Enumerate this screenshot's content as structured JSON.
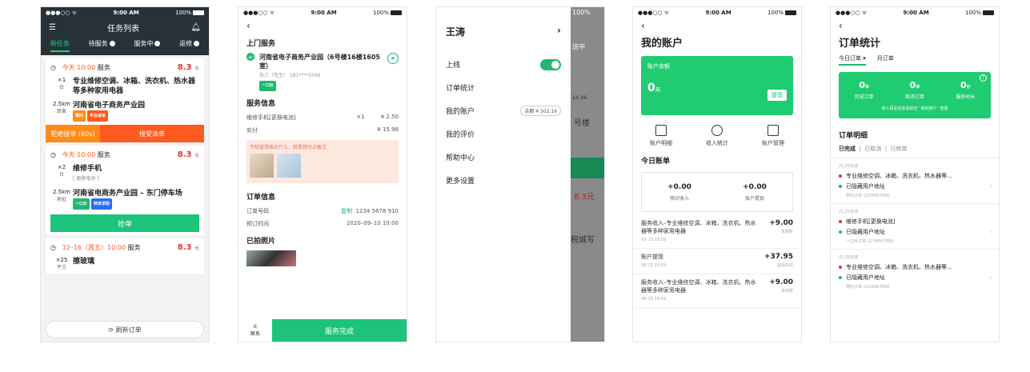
{
  "status": {
    "time": "9:00 AM",
    "battery": "100%"
  },
  "p1": {
    "title": "任务列表",
    "tabs": [
      "新任务",
      "待服务",
      "服务中",
      "返修"
    ],
    "cards": [
      {
        "time": "今天 10:00",
        "type": "服务",
        "price": "8.3",
        "unit": "元",
        "qty": "×1",
        "qtyu": "台",
        "title": "专业维修空调、冰箱、洗衣机、热水器等多种家用电器",
        "dist": "2.5km",
        "distu": "距离",
        "addr": "河南省电子商务产业园",
        "tags": [
          "预约",
          "平台派单"
        ]
      },
      {
        "time": "今天 10:00",
        "type": "服务",
        "price": "8.3",
        "unit": "元",
        "qty": "×2",
        "qtyu": "台",
        "title": "维修手机",
        "sub": "[ 更换电池 ]",
        "dist": "2.5km",
        "distu": "地址",
        "addr": "河南省电商务产业园 – 东门停车场",
        "tags": [
          "一口价",
          "转单求助"
        ]
      },
      {
        "time": "12–16（周五）10:00",
        "type": "服务",
        "price": "8.3",
        "unit": "元",
        "qty": "×25",
        "qtyu": "平方",
        "title": "擦玻璃"
      }
    ],
    "reject": "拒绝接单 (60s)",
    "accept": "接受派单",
    "grab": "抢单",
    "refresh": "刷新订单"
  },
  "p2": {
    "sec1": "上门服务",
    "addr": "河南省电子商务产业园（6号楼16楼1605室）",
    "person": "张三（先生）  181****5566",
    "tag": "一口价",
    "sec2": "服务信息",
    "item": "维修手机[更换电池]",
    "item_qty": "×1",
    "item_price": "¥ 2.50",
    "paid": "实付",
    "paid_val": "¥ 15.98",
    "note": "不知道想表达什么，就是想写点备注",
    "sec3": "订单信息",
    "ono": "订单号码",
    "copy": "复制",
    "ono_val": "1234 5678 910",
    "otime": "预订时间",
    "otime_val": "2020–09–10 10:00",
    "sec4": "已拍照片",
    "contact": "联系",
    "done": "服务完成"
  },
  "p3": {
    "name": "王涛",
    "online": "上线",
    "items": [
      "订单统计",
      "我的账户",
      "我的评价",
      "帮助中心",
      "更多设置"
    ],
    "balance": "余额 ¥ 502.16",
    "ov": [
      "送中",
      "24–06",
      "号楼",
      "8.3元",
      "税城写"
    ]
  },
  "p4": {
    "title": "我的账户",
    "bal_label": "账户余额",
    "bal": "0",
    "bal_unit": "元",
    "withdraw": "提现",
    "icons": [
      "账户明细",
      "收入统计",
      "账户管理"
    ],
    "today": "今日账单",
    "est": "+0.00",
    "est_l": "预计收入",
    "wd": "+0.00",
    "wd_l": "账户提现",
    "bills": [
      {
        "t": "服务收入–专业维修空调、冰箱、洗衣机、热水器等多种家用电器",
        "d": "09–23 18:59",
        "a": "+9.00",
        "s": "未到账"
      },
      {
        "t": "账户提现",
        "d": "09–23 18:59",
        "a": "+37.95",
        "s": "提现失败"
      },
      {
        "t": "服务收入–专业维修空调、冰箱、洗衣机、热水器等多种家用电器",
        "d": "09–23 18:59",
        "a": "+9.00",
        "s": "未到账"
      }
    ]
  },
  "p5": {
    "title": "订单统计",
    "tab1": "今日订单",
    "tab2": "月订单",
    "stats": [
      {
        "v": "0",
        "u": "单",
        "l": "完成订单"
      },
      {
        "v": "0",
        "u": "单",
        "l": "取消订单"
      },
      {
        "v": "0",
        "u": "分",
        "l": "服务时长"
      }
    ],
    "foot": "收入相关信息请前往“ 我的账户 ”查看",
    "sec": "订单明细",
    "filters": [
      "已完成",
      "已取消",
      "已转单"
    ],
    "orders": [
      {
        "tm": "21:25完成",
        "a": "专业维修空调、冰箱、洗衣机、热水器等…",
        "b": "已隐藏用户地址",
        "c": "预约订单–1234567890"
      },
      {
        "tm": "21:25完成",
        "a": "维修手机[更换电池]",
        "b": "已隐藏用户地址",
        "c": "一口价订单–1234567890"
      },
      {
        "tm": "21:25完成",
        "a": "专业维修空调、冰箱、洗衣机、热水器等…",
        "b": "已隐藏用户地址",
        "c": "预约订单–1234567890"
      }
    ]
  }
}
